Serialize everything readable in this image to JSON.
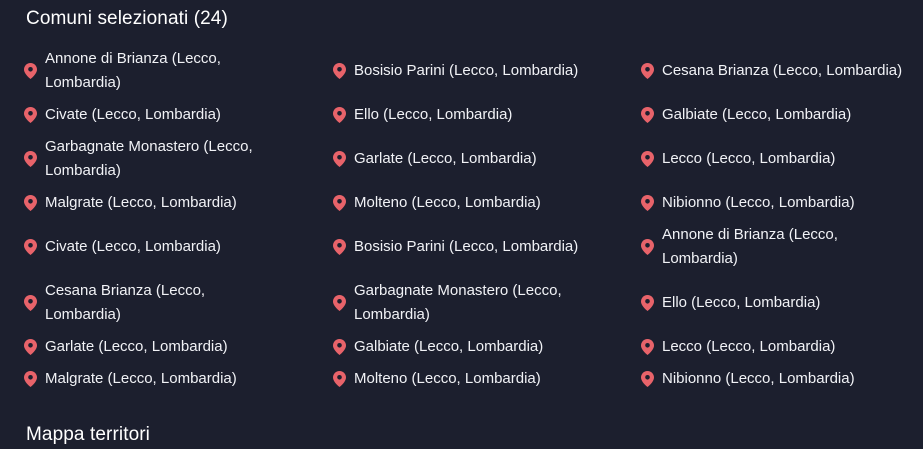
{
  "header": {
    "title": "Comuni selezionati (24)"
  },
  "colors": {
    "background": "#1c1f2e",
    "pin": "#e8636a",
    "text": "#f1f2f6"
  },
  "icon": "map-pin-icon",
  "comuni": [
    "Annone di Brianza (Lecco, Lombardia)",
    "Bosisio Parini (Lecco, Lombardia)",
    "Cesana Brianza (Lecco, Lombardia)",
    "Civate (Lecco, Lombardia)",
    "Ello (Lecco, Lombardia)",
    "Galbiate (Lecco, Lombardia)",
    "Garbagnate Monastero (Lecco, Lombardia)",
    "Garlate (Lecco, Lombardia)",
    "Lecco (Lecco, Lombardia)",
    "Malgrate (Lecco, Lombardia)",
    "Molteno (Lecco, Lombardia)",
    "Nibionno (Lecco, Lombardia)",
    "Civate (Lecco, Lombardia)",
    "Bosisio Parini (Lecco, Lombardia)",
    "Annone di Brianza (Lecco, Lombardia)",
    "Cesana Brianza (Lecco, Lombardia)",
    "Garbagnate Monastero (Lecco, Lombardia)",
    "Ello (Lecco, Lombardia)",
    "Garlate (Lecco, Lombardia)",
    "Galbiate (Lecco, Lombardia)",
    "Lecco (Lecco, Lombardia)",
    "Malgrate (Lecco, Lombardia)",
    "Molteno (Lecco, Lombardia)",
    "Nibionno (Lecco, Lombardia)"
  ],
  "map_section": {
    "title": "Mappa territori"
  }
}
